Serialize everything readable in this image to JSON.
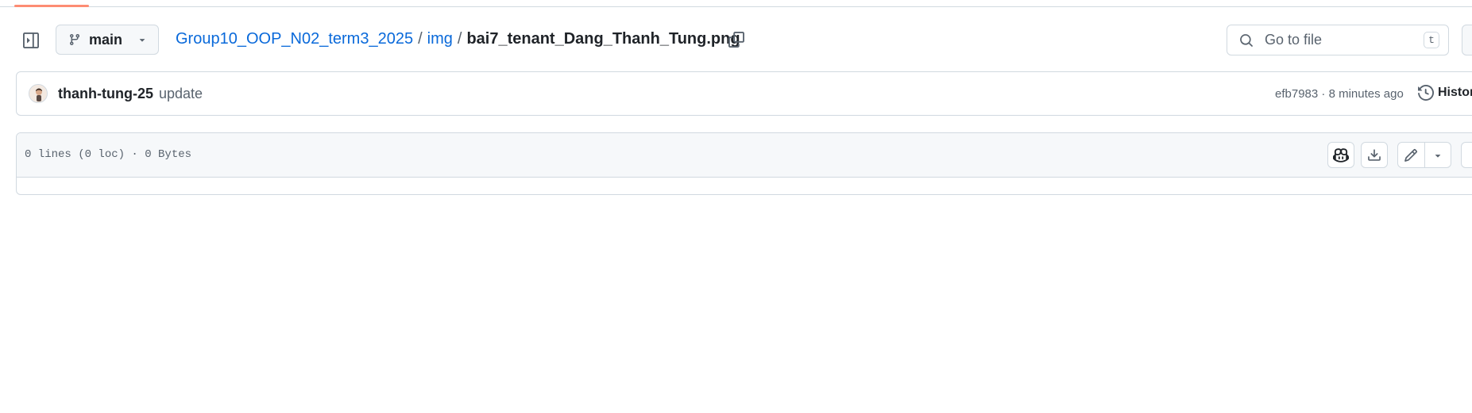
{
  "repo": {
    "branch": "main",
    "breadcrumb": {
      "repo_name": "Group10_OOP_N02_term3_2025",
      "separator": "/",
      "folder": "img",
      "file": "bai7_tenant_Dang_Thanh_Tung.png"
    }
  },
  "search": {
    "placeholder": "Go to file",
    "shortcut": "t"
  },
  "commit": {
    "author": "thanh-tung-25",
    "message": "update",
    "sha": "efb7983",
    "time_separator": " · ",
    "time": "8 minutes ago",
    "history_label": "History"
  },
  "file": {
    "info": "0 lines (0 loc) · 0 Bytes"
  },
  "icons": {
    "sidebar": "sidebar-expand-icon",
    "branch": "git-branch-icon",
    "copy": "copy-icon",
    "search": "search-icon",
    "history": "history-icon",
    "copilot": "copilot-icon",
    "download": "download-icon",
    "edit": "pencil-icon",
    "dropdown": "triangle-down-icon"
  },
  "colors": {
    "link": "#0969da",
    "accent_underline": "#fd8c73",
    "border": "#d1d9e0",
    "muted_text": "#59636e"
  }
}
